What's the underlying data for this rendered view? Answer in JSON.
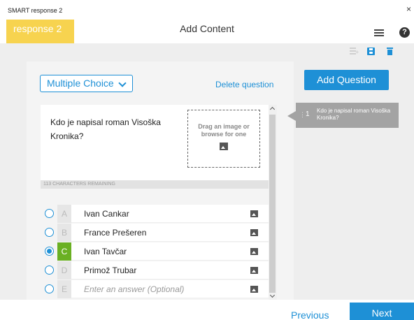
{
  "window": {
    "title": "SMART response 2",
    "close_glyph": "×"
  },
  "header": {
    "brand": "response 2",
    "page_title": "Add Content",
    "menu_icon": "hamburger-menu-icon",
    "help_label": "?"
  },
  "toolbar": {
    "icons": [
      "add-list-icon",
      "save-icon",
      "trash-icon"
    ],
    "accent": "#1e90d6"
  },
  "editor": {
    "question_type": "Multiple Choice",
    "delete_label": "Delete question",
    "question_text": "Kdo je napisal roman Visoška Kronika?",
    "dropzone_text": "Drag an image or browse for one",
    "chars_remaining": "113 CHARACTERS REMAINING",
    "answers": [
      {
        "letter": "A",
        "text": "Ivan Cankar",
        "correct": false
      },
      {
        "letter": "B",
        "text": "France Prešeren",
        "correct": false
      },
      {
        "letter": "C",
        "text": "Ivan Tavčar",
        "correct": true
      },
      {
        "letter": "D",
        "text": "Primož Trubar",
        "correct": false
      },
      {
        "letter": "E",
        "placeholder": "Enter an answer (Optional)",
        "correct": false
      }
    ]
  },
  "sidebar": {
    "add_question_label": "Add Question",
    "questions": [
      {
        "number": "1",
        "text": "Kdo je napisal roman Visoška Kronika?",
        "drag_handle": "⋮"
      }
    ]
  },
  "footer": {
    "previous_label": "Previous",
    "next_label": "Next"
  },
  "colors": {
    "brand": "#f7d34f",
    "accent": "#1e90d6",
    "correct": "#6ab023"
  }
}
